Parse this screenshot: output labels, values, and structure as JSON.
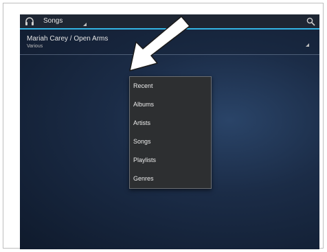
{
  "action_bar": {
    "nav_label": "Songs",
    "nav_icon": "headphones-icon",
    "search_icon": "search-icon"
  },
  "now_playing": {
    "title": "Mariah Carey / Open Arms",
    "subtitle": "Various"
  },
  "menu": {
    "items": [
      "Recent",
      "Albums",
      "Artists",
      "Songs",
      "Playlists",
      "Genres"
    ]
  },
  "colors": {
    "accent": "#33b5e5",
    "menu_bg": "#2d2f31",
    "actionbar_bg": "#1e2633"
  }
}
